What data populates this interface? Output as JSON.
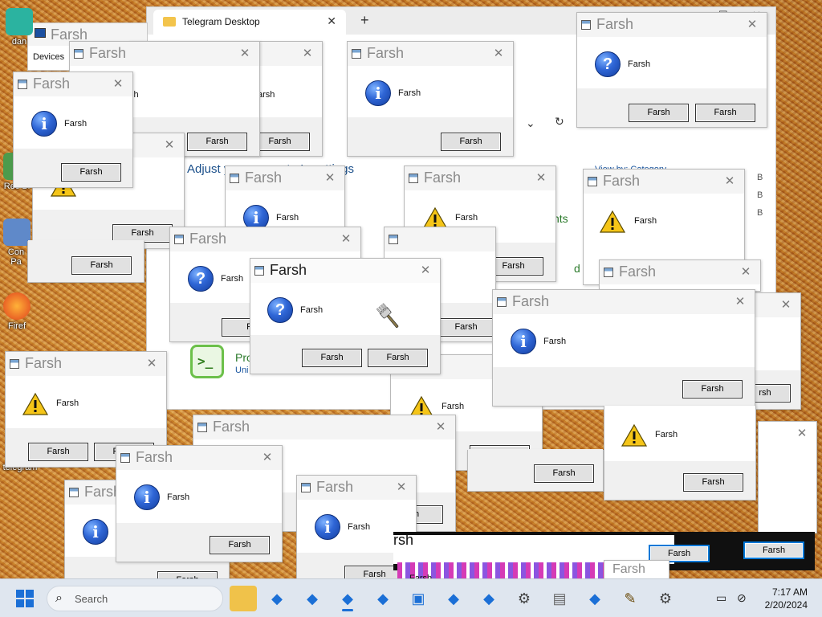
{
  "explorer": {
    "tab_title": "Telegram Desktop",
    "breadcrumb_devices": "Devices",
    "heading": "Adjust your computer's settings",
    "green_texts": [
      "nts",
      "d"
    ],
    "program_title": "Pro",
    "program_sub": "Uni",
    "view_by_text": "View by: Category",
    "side_letters": [
      "B",
      "B",
      "B"
    ]
  },
  "desktop_icons": [
    {
      "label": "dan"
    },
    {
      "label": "Rec\nBi"
    },
    {
      "label": "Con\nPa"
    },
    {
      "label": "Firef"
    },
    {
      "label": "telegram"
    }
  ],
  "dialog": {
    "title": "Farsh",
    "message": "Farsh",
    "button": "Farsh"
  },
  "partial_texts": {
    "sh": "sh",
    "arsh": "arsh",
    "fa": "Fa",
    "rsh": "rsh",
    "dialog_w": "Farsh",
    "farsh_glitch": "Farsh"
  },
  "taskbar": {
    "search_placeholder": "Search",
    "time": "7:17 AM",
    "date": "2/20/2024",
    "glitch_label": "Farsh"
  },
  "colors": {
    "accent": "#0078d7",
    "info_icon": "#2f66d6",
    "warning_icon": "#f5c518"
  }
}
